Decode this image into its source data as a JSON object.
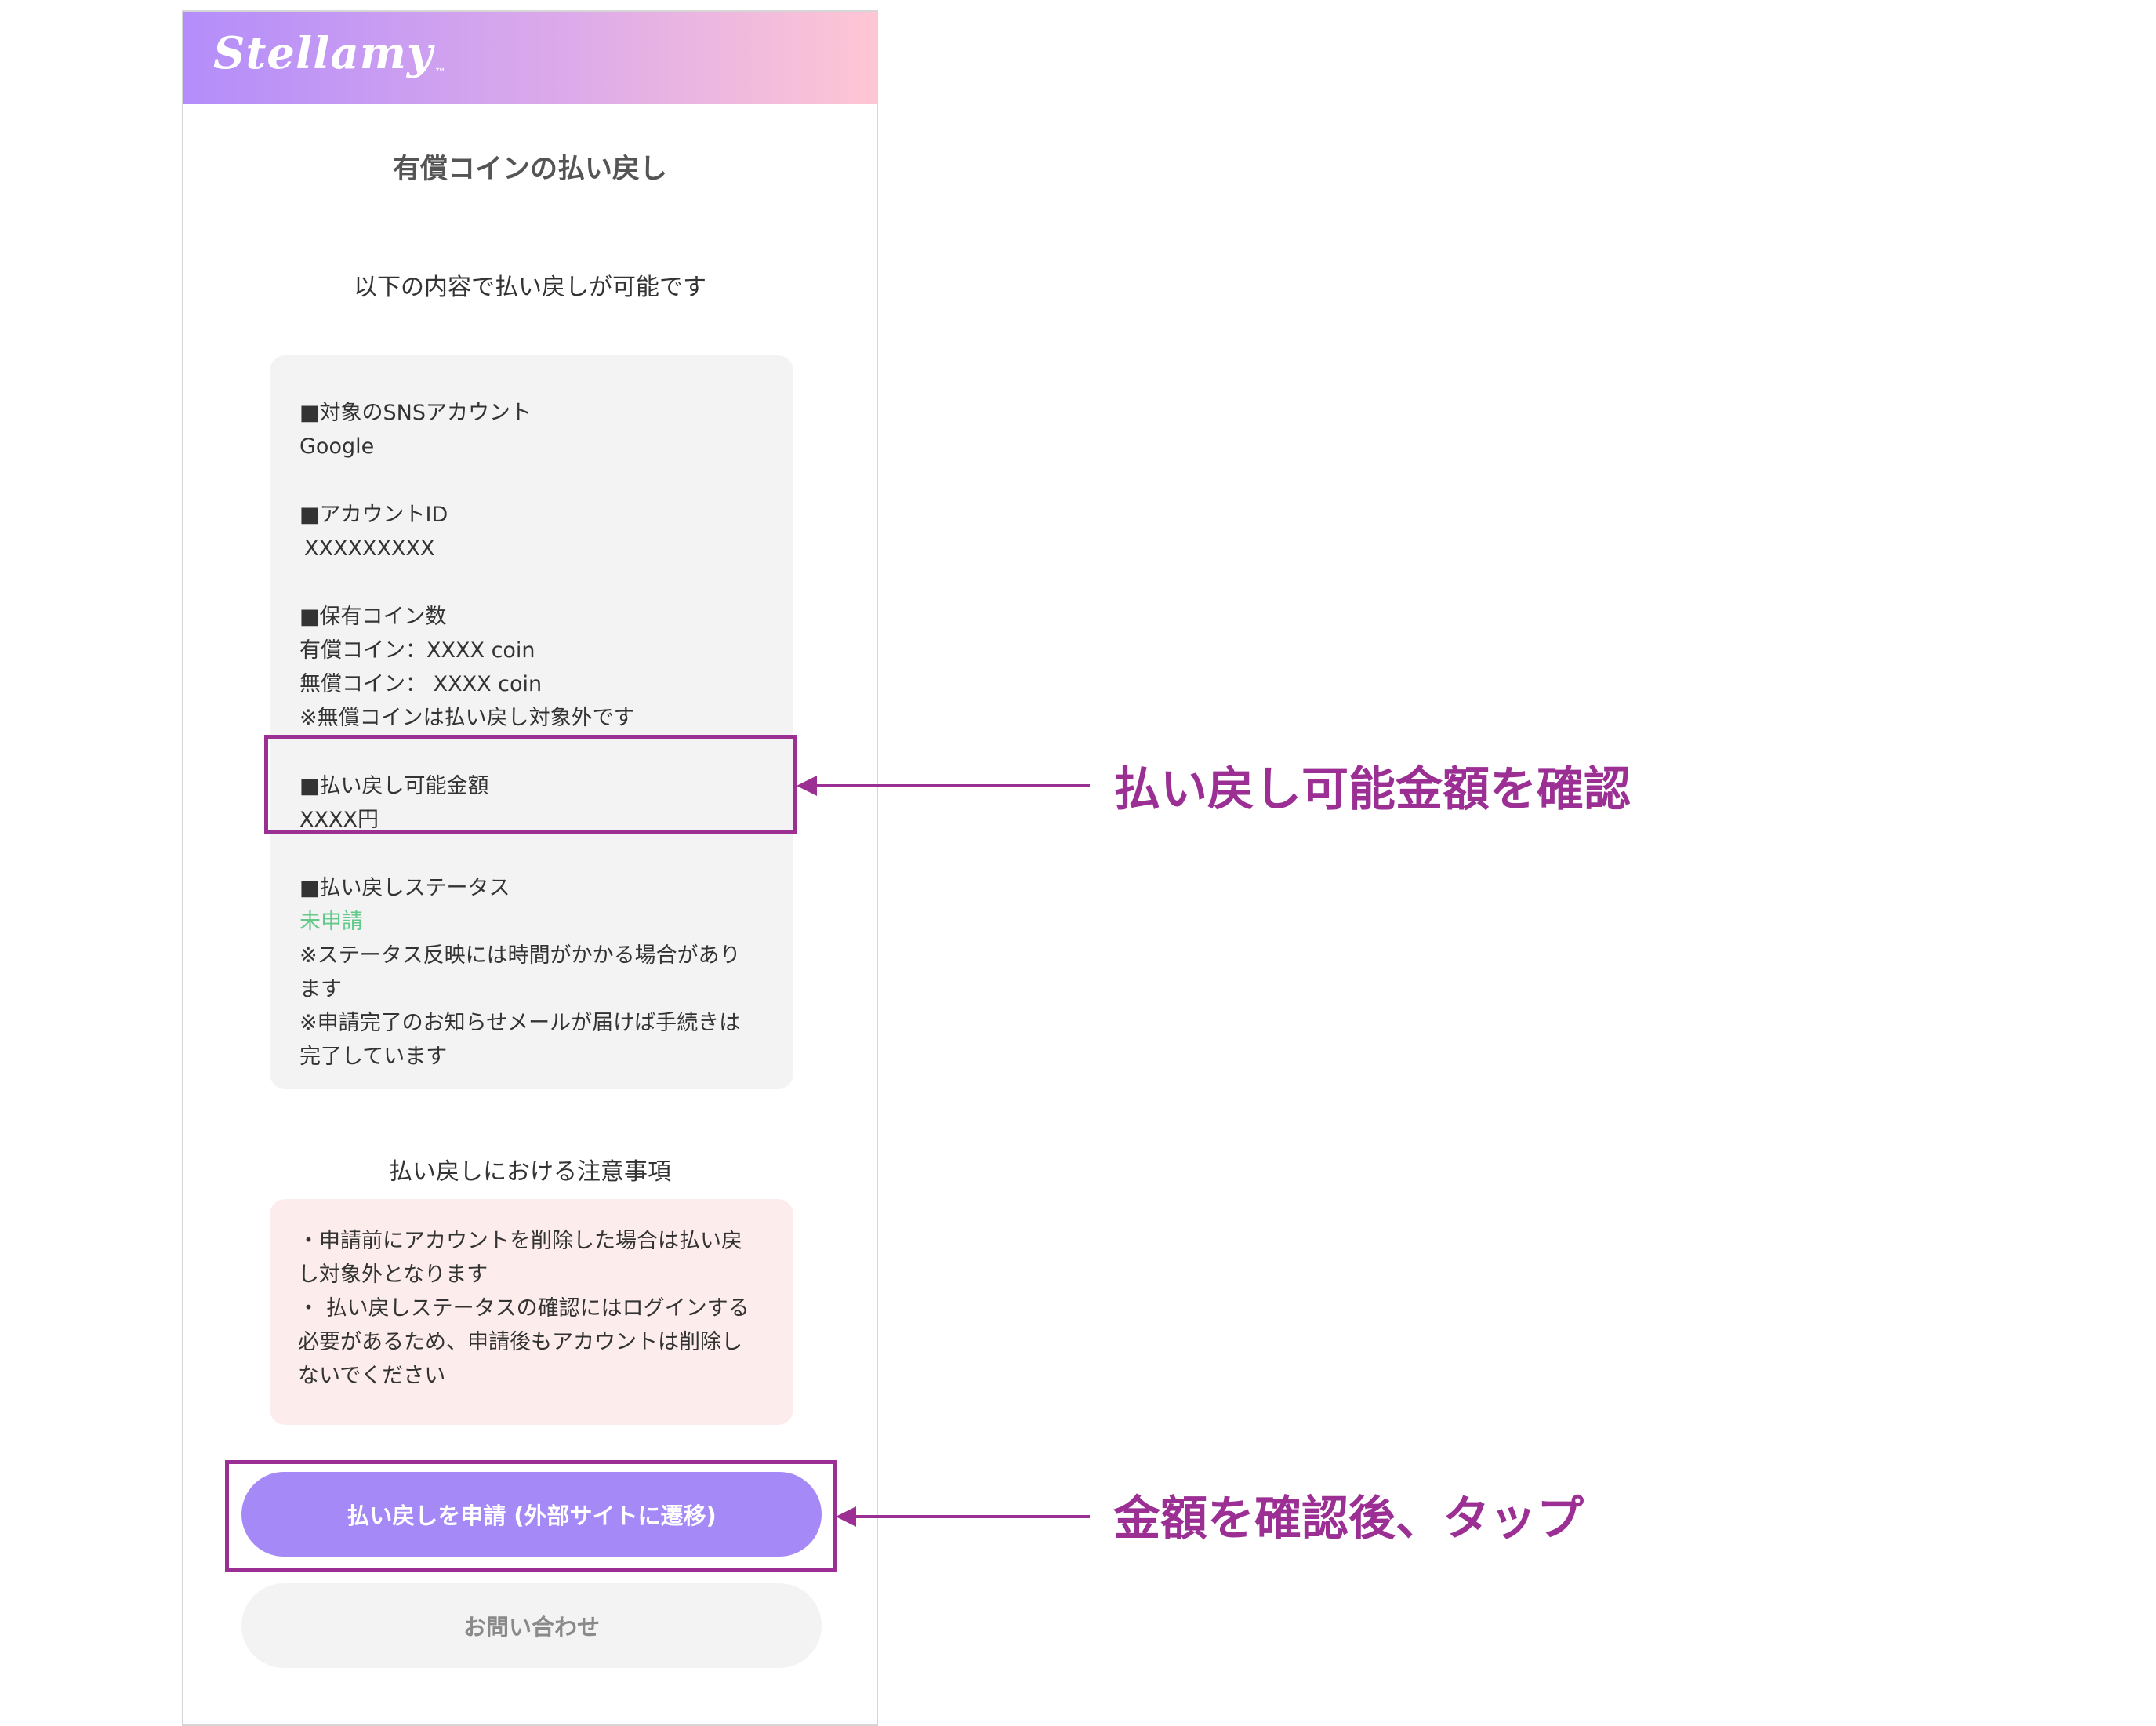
{
  "header": {
    "logo_text": "Stellamy",
    "logo_tm": "™"
  },
  "page_title": "有償コインの払い戻し",
  "intro_text": "以下の内容で払い戻しが可能です",
  "info": {
    "sns_label": "■対象のSNSアカウント",
    "sns_value": "Google",
    "account_id_label": "■アカウントID",
    "account_id_value": "XXXXXXXXX",
    "coins_label": "■保有コイン数",
    "paid_coins": "有償コイン：XXXX coin",
    "free_coins": "無償コイン： XXXX coin",
    "free_coin_note": "※無償コインは払い戻し対象外です",
    "refund_amount_label": "■払い戻し可能金額",
    "refund_amount_value": "XXXX円",
    "status_label": "■払い戻しステータス",
    "status_value": "未申請",
    "status_note_line1": "※ステータス反映には時間がかかる場合があり",
    "status_note_line2": "ます",
    "mail_note_line1": "※申請完了のお知らせメールが届けば手続きは",
    "mail_note_line2": "完了しています",
    "status_color": "#62c98b"
  },
  "notice": {
    "title": "払い戻しにおける注意事項",
    "line1": "・申請前にアカウントを削除した場合は払い戻",
    "line2": "し対象外となります",
    "line3": "・ 払い戻しステータスの確認にはログインする",
    "line4": "必要があるため、申請後もアカウントは削除し",
    "line5": "ないでください"
  },
  "buttons": {
    "apply_label": "払い戻しを申請 (外部サイトに遷移)",
    "contact_label": "お問い合わせ"
  },
  "annotations": {
    "amount_note": "払い戻し可能金額を確認",
    "tap_note": "金額を確認後、タップ",
    "accent_color": "#9b2f94"
  }
}
